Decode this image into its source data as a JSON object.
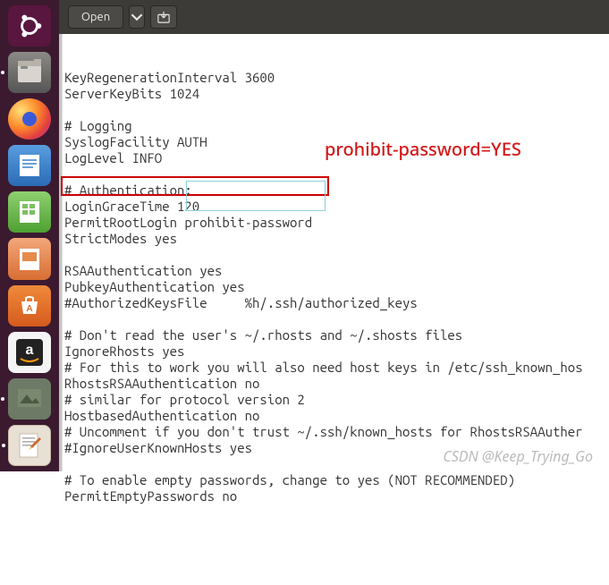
{
  "launcher": {
    "items": [
      {
        "name": "ubuntu-dash",
        "running": false
      },
      {
        "name": "files",
        "running": true
      },
      {
        "name": "firefox",
        "running": false
      },
      {
        "name": "libreoffice-writer",
        "running": false
      },
      {
        "name": "libreoffice-calc",
        "running": false
      },
      {
        "name": "libreoffice-impress",
        "running": false
      },
      {
        "name": "ubuntu-software",
        "running": false
      },
      {
        "name": "amazon",
        "running": false
      },
      {
        "name": "wallpaper",
        "running": true
      },
      {
        "name": "text-editor",
        "running": true
      }
    ]
  },
  "toolbar": {
    "open_label": "Open"
  },
  "editor": {
    "lines": [
      "KeyRegenerationInterval 3600",
      "ServerKeyBits 1024",
      "",
      "# Logging",
      "SyslogFacility AUTH",
      "LogLevel INFO",
      "",
      "# Authentication:",
      "LoginGraceTime 120",
      "PermitRootLogin prohibit-password",
      "StrictModes yes",
      "",
      "RSAAuthentication yes",
      "PubkeyAuthentication yes",
      "#AuthorizedKeysFile     %h/.ssh/authorized_keys",
      "",
      "# Don't read the user's ~/.rhosts and ~/.shosts files",
      "IgnoreRhosts yes",
      "# For this to work you will also need host keys in /etc/ssh_known_hos",
      "RhostsRSAAuthentication no",
      "# similar for protocol version 2",
      "HostbasedAuthentication no",
      "# Uncomment if you don't trust ~/.ssh/known_hosts for RhostsRSAAuther",
      "#IgnoreUserKnownHosts yes",
      "",
      "# To enable empty passwords, change to yes (NOT RECOMMENDED)",
      "PermitEmptyPasswords no",
      ""
    ]
  },
  "annotation": {
    "text": "prohibit-password=YES"
  },
  "watermark": {
    "text": "CSDN @Keep_Trying_Go"
  }
}
